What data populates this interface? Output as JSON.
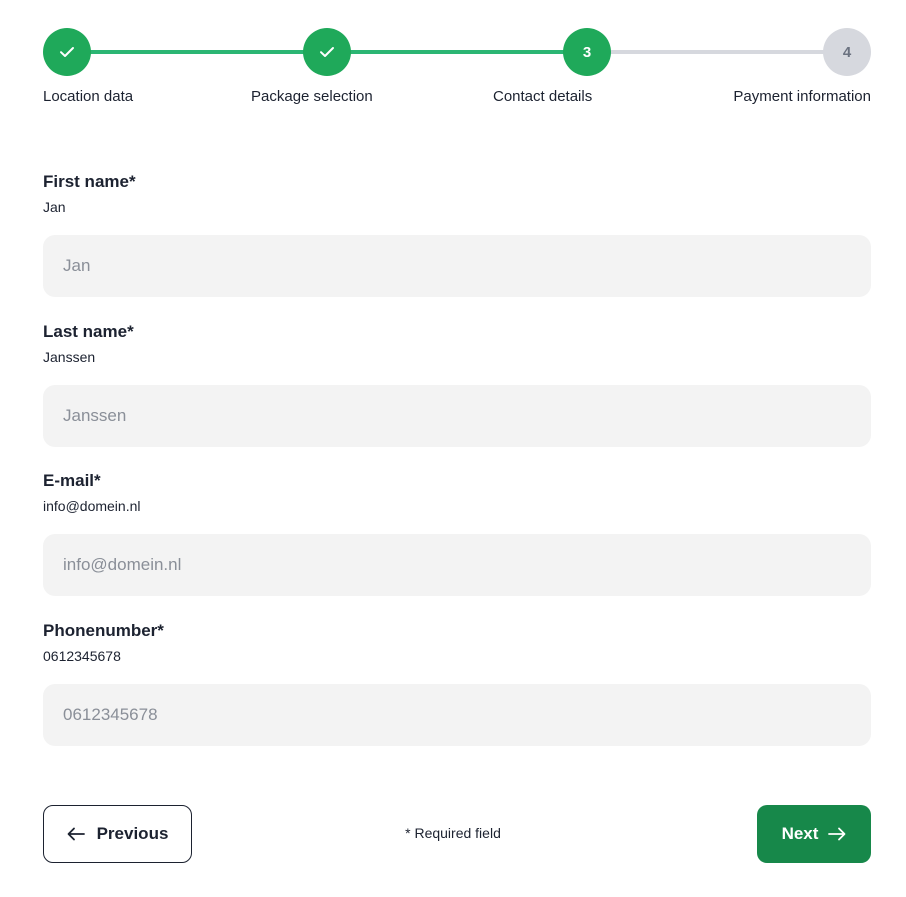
{
  "stepper": {
    "steps": [
      {
        "label": "Location data",
        "status": "done",
        "marker": "check-icon"
      },
      {
        "label": "Package selection",
        "status": "done",
        "marker": "check-icon"
      },
      {
        "label": "Contact details",
        "status": "active",
        "number": "3"
      },
      {
        "label": "Payment information",
        "status": "todo",
        "number": "4"
      }
    ]
  },
  "form": {
    "first_name": {
      "label": "First name*",
      "value": "Jan",
      "placeholder": "Jan"
    },
    "last_name": {
      "label": "Last name*",
      "value": "Janssen",
      "placeholder": "Janssen"
    },
    "email": {
      "label": "E-mail*",
      "value": "info@domein.nl",
      "placeholder": "info@domein.nl"
    },
    "phone": {
      "label": "Phonenumber*",
      "value": "0612345678",
      "placeholder": "0612345678"
    }
  },
  "footer": {
    "previous_label": "Previous",
    "required_note": "* Required field",
    "next_label": "Next",
    "previous_icon": "arrow-left-icon",
    "next_icon": "arrow-right-icon"
  },
  "colors": {
    "accent_green": "#1fa95a",
    "progress_green": "#2bb673",
    "next_button_green": "#17884a",
    "inactive_gray": "#d6d8de",
    "input_background": "#f3f3f3",
    "text_dark": "#1c2230"
  }
}
